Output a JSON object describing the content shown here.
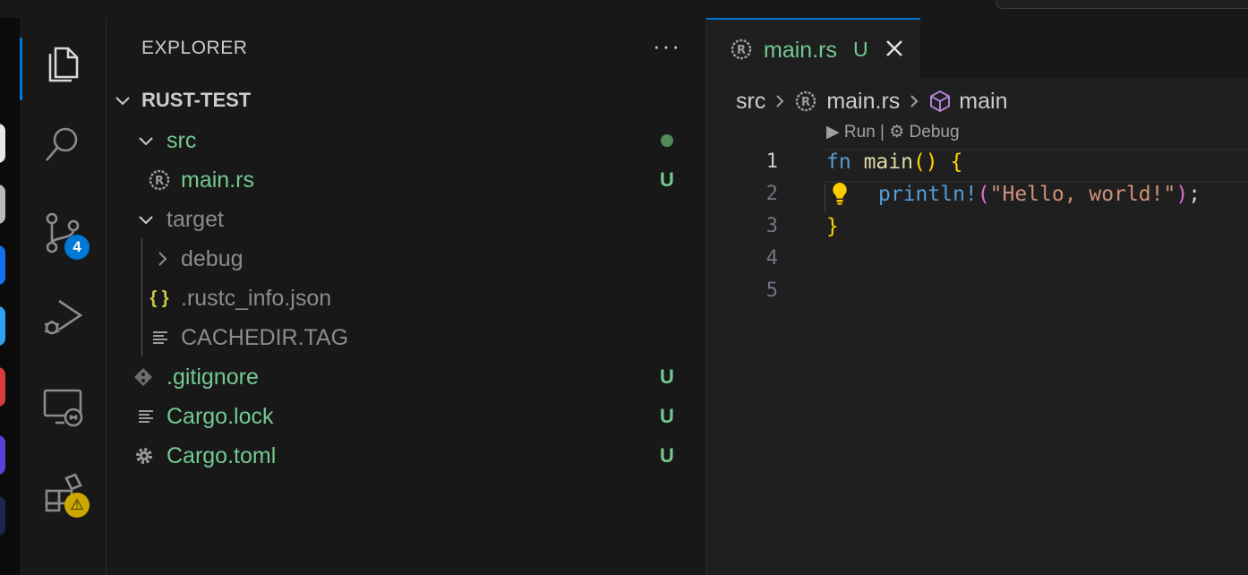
{
  "sidebar": {
    "title": "EXPLORER",
    "more": "···",
    "project": "RUST-TEST",
    "tree": {
      "src": "src",
      "main_rs": "main.rs",
      "main_rs_status": "U",
      "target": "target",
      "debug": "debug",
      "rustc_info": ".rustc_info.json",
      "cachedir": "CACHEDIR.TAG",
      "gitignore": ".gitignore",
      "gitignore_status": "U",
      "cargo_lock": "Cargo.lock",
      "cargo_lock_status": "U",
      "cargo_toml": "Cargo.toml",
      "cargo_toml_status": "U",
      "json_icon": "{ }"
    }
  },
  "activity": {
    "source_control_badge": "4",
    "extensions_badge": "⚠"
  },
  "editor": {
    "tab": {
      "label": "main.rs",
      "status": "U"
    },
    "breadcrumb": {
      "folder": "src",
      "file": "main.rs",
      "symbol": "main"
    },
    "codelens": "▶ Run | ⚙ Debug",
    "line_numbers": [
      "1",
      "2",
      "3",
      "4",
      "5"
    ],
    "code": {
      "l1_kw": "fn",
      "l1_name": "main",
      "l1_parens": "()",
      "l1_brace": "{",
      "l2_macro": "println!",
      "l2_open": "(",
      "l2_str": "\"Hello, world!\"",
      "l2_close": ")",
      "l2_semi": ";",
      "l3_brace": "}"
    }
  },
  "colors": {
    "accent": "#0078d4",
    "git_untracked": "#73c991",
    "warning": "#cca700"
  }
}
